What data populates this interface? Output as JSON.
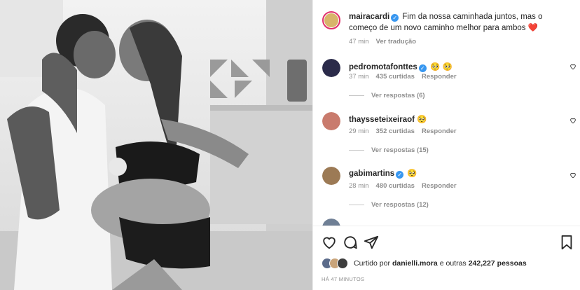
{
  "colors": {
    "accent": "#3897f0",
    "muted": "#8e8e8e",
    "heart": "#ed4956",
    "text": "#262626"
  },
  "post": {
    "image_alt": "black and white photo",
    "author": "mairacardi",
    "caption": "Fim da nossa caminhada juntos, mas o começo de um novo caminho melhor para ambos",
    "caption_emoji": "❤️",
    "time": "47 min",
    "translate": "Ver tradução"
  },
  "comments": [
    {
      "user": "pedromotafonttes",
      "verified": true,
      "text": "🥺 🥺",
      "time": "37 min",
      "likes": "435 curtidas",
      "reply": "Responder",
      "view_replies": "Ver respostas (6)"
    },
    {
      "user": "thaysseteixeiraof",
      "verified": false,
      "text": "🥺",
      "time": "29 min",
      "likes": "352 curtidas",
      "reply": "Responder",
      "view_replies": "Ver respostas (15)"
    },
    {
      "user": "gabimartins",
      "verified": true,
      "text": "🥺",
      "time": "28 min",
      "likes": "480 curtidas",
      "reply": "Responder",
      "view_replies": "Ver respostas (12)"
    }
  ],
  "liked_by": {
    "prefix": "Curtido por",
    "user": "danielli.mora",
    "middle": "e outras",
    "count": "242,227",
    "suffix": "pessoas"
  },
  "timestamp": "HÁ 47 MINUTOS",
  "icons": [
    "heart-icon",
    "comment-icon",
    "share-icon",
    "bookmark-icon",
    "verified-icon"
  ]
}
